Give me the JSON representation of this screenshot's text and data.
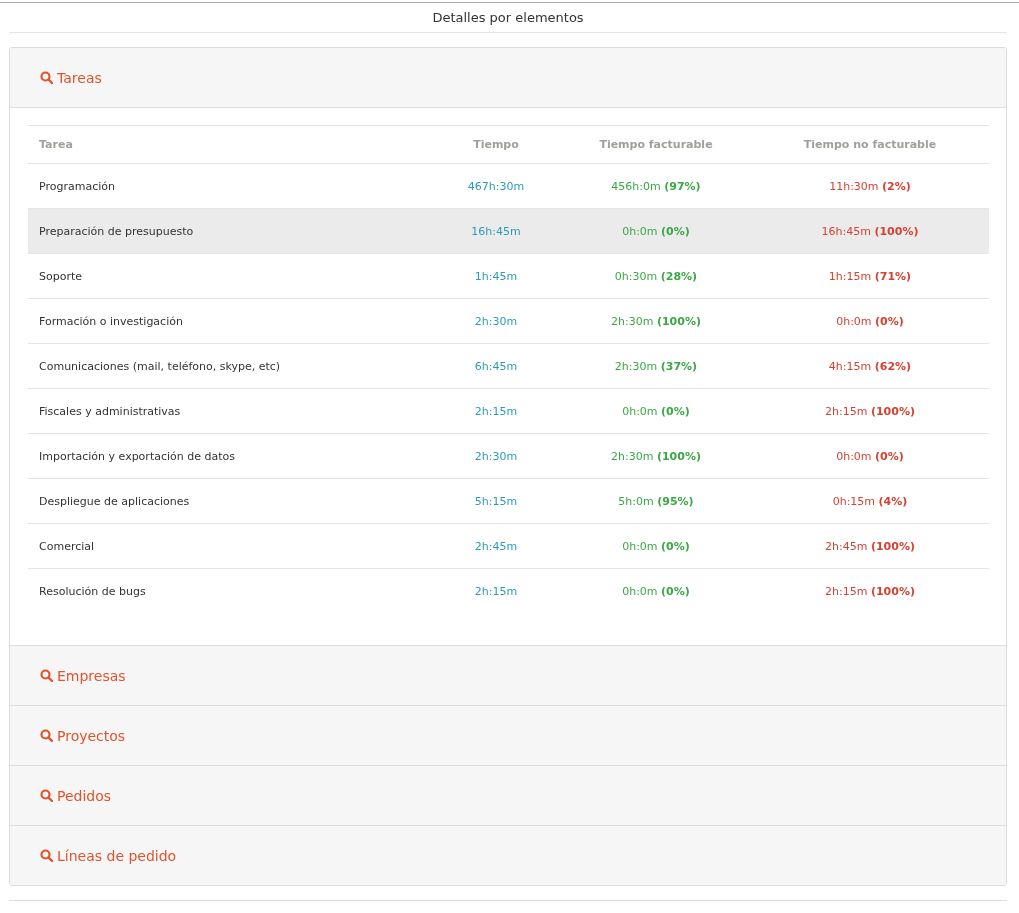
{
  "title": "Detalles por elementos",
  "panels": [
    {
      "label": "Tareas",
      "table": {
        "columns": [
          "Tarea",
          "Tiempo",
          "Tiempo facturable",
          "Tiempo no facturable"
        ],
        "rows": [
          {
            "selected": false,
            "cells": [
              "Programación",
              "467h:30m",
              "456h:0m **(97%)**",
              "11h:30m **(2%)**"
            ]
          },
          {
            "selected": true,
            "cells": [
              "Preparación de presupuesto",
              "16h:45m",
              "0h:0m **(0%)**",
              "16h:45m **(100%)**"
            ]
          },
          {
            "selected": false,
            "cells": [
              "Soporte",
              "1h:45m",
              "0h:30m **(28%)**",
              "1h:15m **(71%)**"
            ]
          },
          {
            "selected": false,
            "cells": [
              "Formación o investigación",
              "2h:30m",
              "2h:30m **(100%)**",
              "0h:0m **(0%)**"
            ]
          },
          {
            "selected": false,
            "cells": [
              "Comunicaciones (mail, teléfono, skype, etc)",
              "6h:45m",
              "2h:30m **(37%)**",
              "4h:15m **(62%)**"
            ]
          },
          {
            "selected": false,
            "cells": [
              "Fiscales y administrativas",
              "2h:15m",
              "0h:0m **(0%)**",
              "2h:15m **(100%)**"
            ]
          },
          {
            "selected": false,
            "cells": [
              "Importación y exportación de datos",
              "2h:30m",
              "2h:30m **(100%)**",
              "0h:0m **(0%)**"
            ]
          },
          {
            "selected": false,
            "cells": [
              "Despliegue de aplicaciones",
              "5h:15m",
              "5h:0m **(95%)**",
              "0h:15m **(4%)**"
            ]
          },
          {
            "selected": false,
            "cells": [
              "Comercial",
              "2h:45m",
              "0h:0m **(0%)**",
              "2h:45m **(100%)**"
            ]
          },
          {
            "selected": false,
            "cells": [
              "Resolución de bugs",
              "2h:15m",
              "0h:0m **(0%)**",
              "2h:15m **(100%)**"
            ]
          }
        ]
      }
    },
    {
      "label": "Empresas"
    },
    {
      "label": "Proyectos"
    },
    {
      "label": "Pedidos"
    },
    {
      "label": "Líneas de pedido"
    }
  ]
}
